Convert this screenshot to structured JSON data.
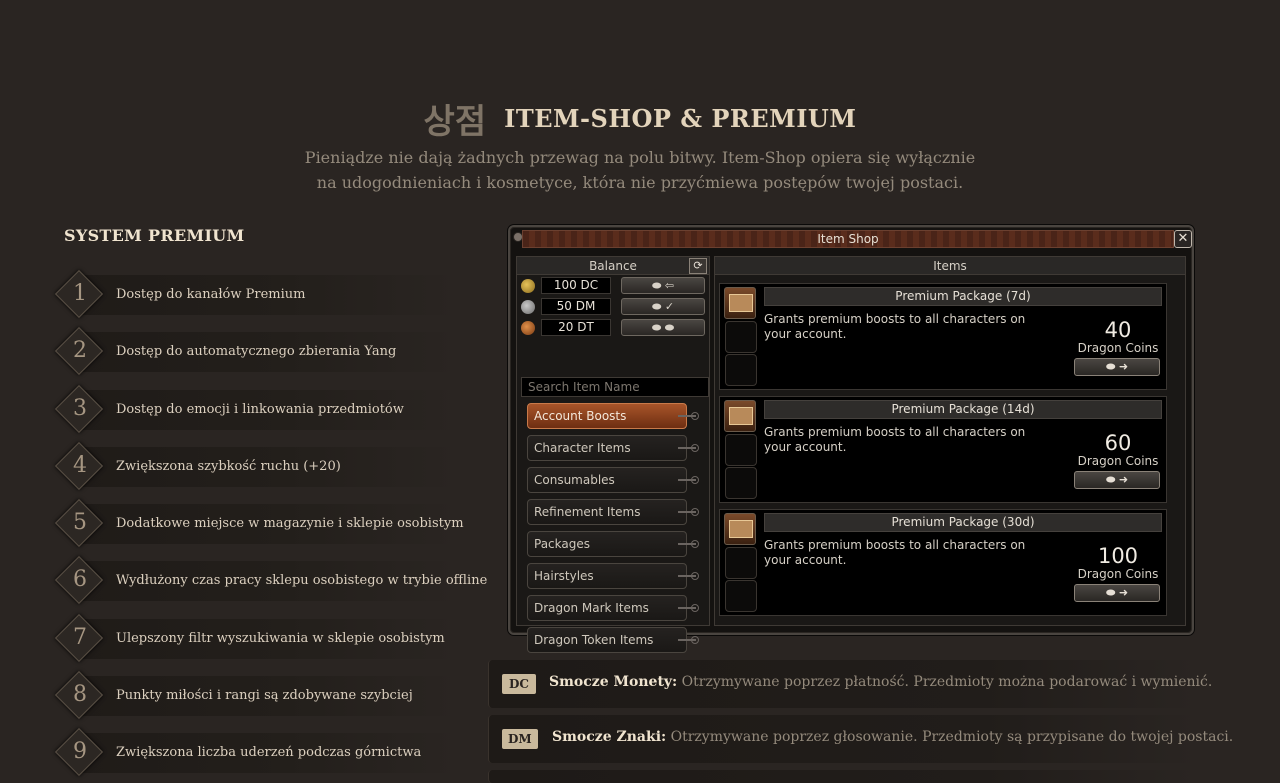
{
  "header": {
    "korean": "상점",
    "title": "ITEM-SHOP & PREMIUM",
    "subtitle": "Pieniądze nie dają żadnych przewag na polu bitwy. Item-Shop opiera się wyłącznie na udogodnieniach i kosmetyce, która nie przyćmiewa postępów twojej postaci."
  },
  "premium": {
    "title": "SYSTEM PREMIUM",
    "items": [
      {
        "num": "1",
        "text": "Dostęp do kanałów Premium"
      },
      {
        "num": "2",
        "text": "Dostęp do automatycznego zbierania Yang"
      },
      {
        "num": "3",
        "text": "Dostęp do emocji i linkowania przedmiotów"
      },
      {
        "num": "4",
        "text": "Zwiększona szybkość ruchu (+20)"
      },
      {
        "num": "5",
        "text": "Dodatkowe miejsce w magazynie i sklepie osobistym"
      },
      {
        "num": "6",
        "text": "Wydłużony czas pracy sklepu osobistego w trybie offline"
      },
      {
        "num": "7",
        "text": "Ulepszony filtr wyszukiwania w sklepie osobistym"
      },
      {
        "num": "8",
        "text": "Punkty miłości i rangi są zdobywane szybciej"
      },
      {
        "num": "9",
        "text": "Zwiększona liczba uderzeń podczas górnictwa"
      }
    ]
  },
  "shop": {
    "title": "Item Shop",
    "close": "✕",
    "balance_label": "Balance",
    "refresh": "⟳",
    "balances": [
      {
        "value": "100 DC",
        "button": "⬬ ⇦",
        "coin": "dc"
      },
      {
        "value": "50 DM",
        "button": "⬬ ✓",
        "coin": "dm"
      },
      {
        "value": "20 DT",
        "button": "⬬ ⬬",
        "coin": "dt"
      }
    ],
    "search_placeholder": "Search Item Name",
    "categories": [
      "Account Boosts",
      "Character Items",
      "Consumables",
      "Refinement Items",
      "Packages",
      "Hairstyles",
      "Dragon Mark Items",
      "Dragon Token Items"
    ],
    "active_category": "Account Boosts",
    "items_label": "Items",
    "products": [
      {
        "title": "Premium Package (7d)",
        "desc": "Grants premium boosts to all characters on your account.",
        "price": "40",
        "unit": "Dragon Coins",
        "buy": "⬬ ➜"
      },
      {
        "title": "Premium Package (14d)",
        "desc": "Grants premium boosts to all characters on your account.",
        "price": "60",
        "unit": "Dragon Coins",
        "buy": "⬬ ➜"
      },
      {
        "title": "Premium Package (30d)",
        "desc": "Grants premium boosts to all characters on your account.",
        "price": "100",
        "unit": "Dragon Coins",
        "buy": "⬬ ➜"
      }
    ]
  },
  "currencies": [
    {
      "badge": "DC",
      "name": "Smocze Monety:",
      "desc": " Otrzymywane poprzez płatność. Przedmioty można podarować i wymienić."
    },
    {
      "badge": "DM",
      "name": "Smocze Znaki:",
      "desc": " Otrzymywane poprzez głosowanie. Przedmioty są przypisane do twojej postaci."
    }
  ],
  "colors": {
    "background": "#2a2522",
    "accent": "#a8552a",
    "badge": "#c9b99c"
  }
}
